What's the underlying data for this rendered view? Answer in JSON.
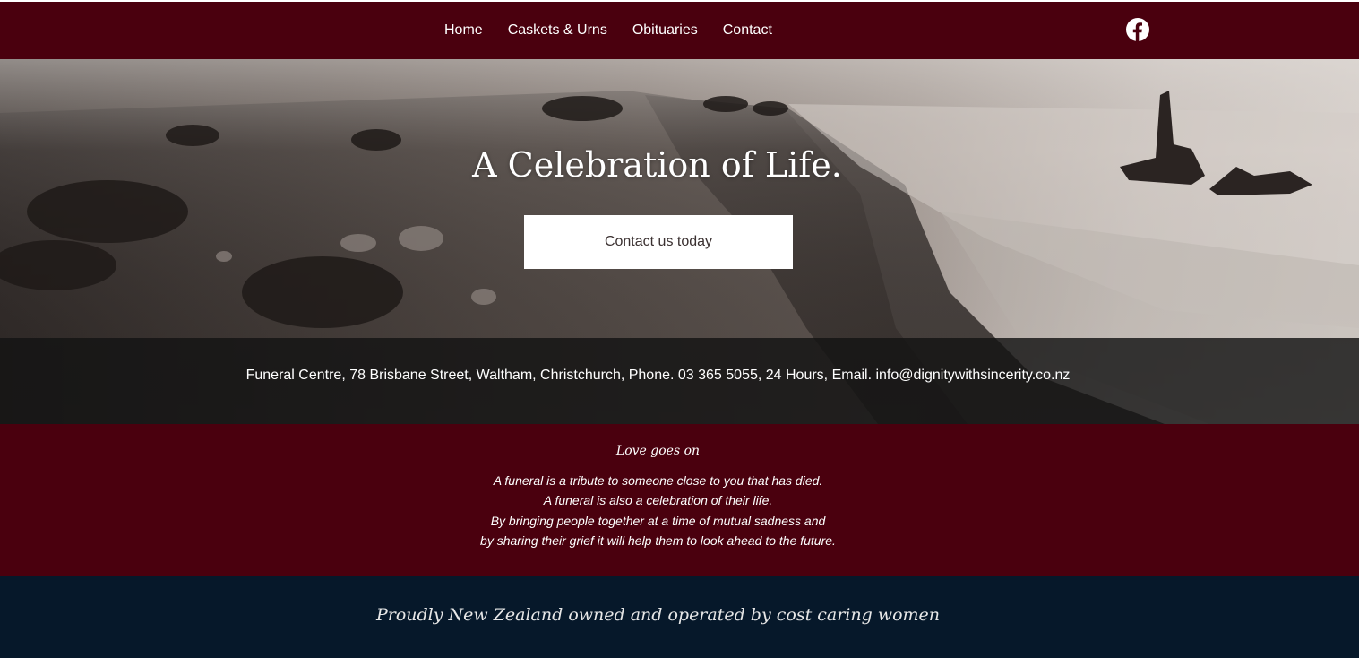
{
  "nav": {
    "items": [
      {
        "label": "Home"
      },
      {
        "label": "Caskets & Urns"
      },
      {
        "label": "Obituaries"
      },
      {
        "label": "Contact"
      }
    ],
    "social_icon": "facebook-icon"
  },
  "hero": {
    "title": "A Celebration of Life.",
    "cta_label": "Contact us today"
  },
  "info": {
    "text": "Funeral Centre, 78 Brisbane Street, Waltham, Christchurch, Phone. 03 365 5055, 24 Hours, Email. info@dignitywithsincerity.co.nz"
  },
  "quote": {
    "title": "Love goes on",
    "lines": [
      "A funeral is a tribute to someone close to you that has died.",
      "A funeral is also a celebration of their life.",
      "By bringing people together at a time of mutual sadness and",
      "by sharing their grief it will help them to look ahead to the future."
    ]
  },
  "footer": {
    "text": "Proudly New Zealand owned and operated by cost caring women"
  },
  "colors": {
    "maroon": "#4a000e",
    "navy": "#06182a",
    "overlay": "#141414"
  }
}
